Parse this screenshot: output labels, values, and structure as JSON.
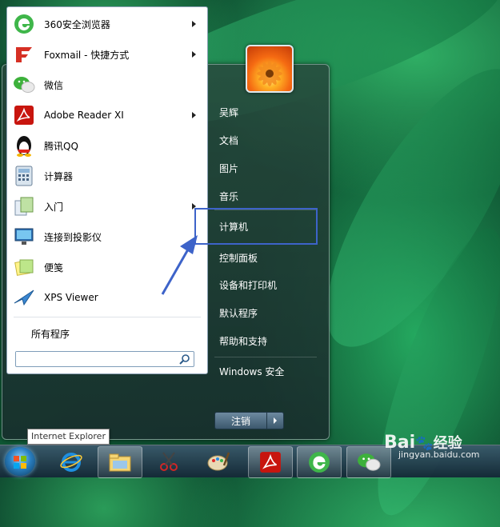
{
  "start_menu": {
    "programs": [
      {
        "label": "360安全浏览器",
        "icon": "360-browser-icon",
        "has_submenu": true
      },
      {
        "label": "Foxmail - 快捷方式",
        "icon": "foxmail-icon",
        "has_submenu": true
      },
      {
        "label": "微信",
        "icon": "wechat-icon",
        "has_submenu": false
      },
      {
        "label": "Adobe Reader XI",
        "icon": "adobe-reader-icon",
        "has_submenu": true
      },
      {
        "label": "腾讯QQ",
        "icon": "qq-penguin-icon",
        "has_submenu": false
      },
      {
        "label": "计算器",
        "icon": "calculator-icon",
        "has_submenu": false
      },
      {
        "label": "入门",
        "icon": "getting-started-icon",
        "has_submenu": true
      },
      {
        "label": "连接到投影仪",
        "icon": "projector-icon",
        "has_submenu": false
      },
      {
        "label": "便笺",
        "icon": "sticky-notes-icon",
        "has_submenu": false
      },
      {
        "label": "XPS Viewer",
        "icon": "xps-viewer-icon",
        "has_submenu": false
      }
    ],
    "all_programs": "所有程序",
    "search": {
      "value": "",
      "placeholder": ""
    },
    "right_items": [
      {
        "label": "吴辉"
      },
      {
        "label": "文档"
      },
      {
        "label": "图片"
      },
      {
        "label": "音乐"
      },
      {
        "label": "计算机"
      },
      {
        "label": "控制面板"
      },
      {
        "label": "设备和打印机"
      },
      {
        "label": "默认程序"
      },
      {
        "label": "帮助和支持"
      },
      {
        "label": "Windows 安全"
      }
    ],
    "shutdown_label": "注销"
  },
  "tooltip": "Internet Explorer",
  "taskbar": {
    "items": [
      "start-orb",
      "internet-explorer-icon",
      "file-explorer-icon",
      "snipping-tool-icon",
      "paint-icon",
      "adobe-reader-icon",
      "360-browser-icon",
      "wechat-icon"
    ]
  },
  "watermark": {
    "brand": "Bai",
    "suffix": "经验",
    "url": "jingyan.baidu.com"
  },
  "colors": {
    "highlight_box": "#3d63c9",
    "arrow": "#3d63c9"
  }
}
